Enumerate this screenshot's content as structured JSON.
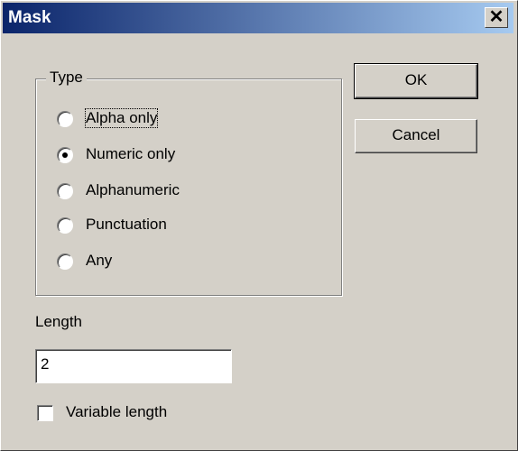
{
  "window": {
    "title": "Mask",
    "close_glyph": "✕"
  },
  "type_group": {
    "label": "Type",
    "options": [
      {
        "label": "Alpha only",
        "checked": false,
        "focused": true
      },
      {
        "label": "Numeric only",
        "checked": true
      },
      {
        "label": "Alphanumeric",
        "checked": false
      },
      {
        "label": "Punctuation",
        "checked": false
      },
      {
        "label": "Any",
        "checked": false
      }
    ]
  },
  "buttons": {
    "ok": "OK",
    "cancel": "Cancel"
  },
  "length": {
    "label": "Length",
    "value": "2"
  },
  "variable_length": {
    "label": "Variable length",
    "checked": false
  },
  "colors": {
    "title_bar_start": "#0a246a",
    "title_bar_end": "#a6caf0",
    "face": "#d4d0c8"
  }
}
